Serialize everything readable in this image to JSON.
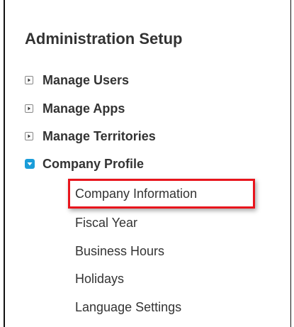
{
  "panel": {
    "title": "Administration Setup",
    "highlight_color": "#e8141c",
    "accent_color": "#1b9dd9"
  },
  "nav": {
    "items": [
      {
        "label": "Manage Users",
        "expanded": false,
        "icon": "expand-arrow-icon"
      },
      {
        "label": "Manage Apps",
        "expanded": false,
        "icon": "expand-arrow-icon"
      },
      {
        "label": "Manage Territories",
        "expanded": false,
        "icon": "expand-arrow-icon"
      },
      {
        "label": "Company Profile",
        "expanded": true,
        "icon": "collapse-arrow-icon"
      }
    ],
    "company_profile_children": [
      {
        "label": "Company Information",
        "highlighted": true
      },
      {
        "label": "Fiscal Year",
        "highlighted": false
      },
      {
        "label": "Business Hours",
        "highlighted": false
      },
      {
        "label": "Holidays",
        "highlighted": false
      },
      {
        "label": "Language Settings",
        "highlighted": false
      }
    ]
  }
}
